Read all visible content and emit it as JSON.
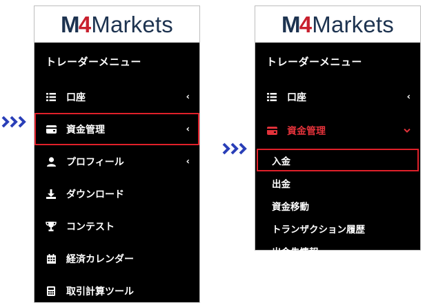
{
  "brand": {
    "logo_m": "M",
    "logo_4": "4",
    "logo_rest": "Markets"
  },
  "menu_title": "トレーダーメニュー",
  "left_menu": {
    "items": [
      {
        "label": "口座",
        "icon": "list-icon",
        "chevron": "‹"
      },
      {
        "label": "資金管理",
        "icon": "wallet-icon",
        "chevron": "‹"
      },
      {
        "label": "プロフィール",
        "icon": "user-icon",
        "chevron": "‹"
      },
      {
        "label": "ダウンロード",
        "icon": "download-icon"
      },
      {
        "label": "コンテスト",
        "icon": "trophy-icon"
      },
      {
        "label": "経済カレンダー",
        "icon": "calendar-icon"
      },
      {
        "label": "取引計算ツール",
        "icon": "calculator-icon"
      }
    ]
  },
  "right_menu": {
    "items": [
      {
        "label": "口座",
        "icon": "list-icon",
        "chevron": "‹"
      },
      {
        "label": "資金管理",
        "icon": "wallet-icon",
        "chevron": "⌄"
      }
    ],
    "submenu": [
      "入金",
      "出金",
      "資金移動",
      "トランザクション履歴",
      "出金先情報"
    ]
  },
  "colors": {
    "accent_red": "#e0202a",
    "arrow_blue": "#2a3fb8",
    "brand_navy": "#1d3350"
  }
}
